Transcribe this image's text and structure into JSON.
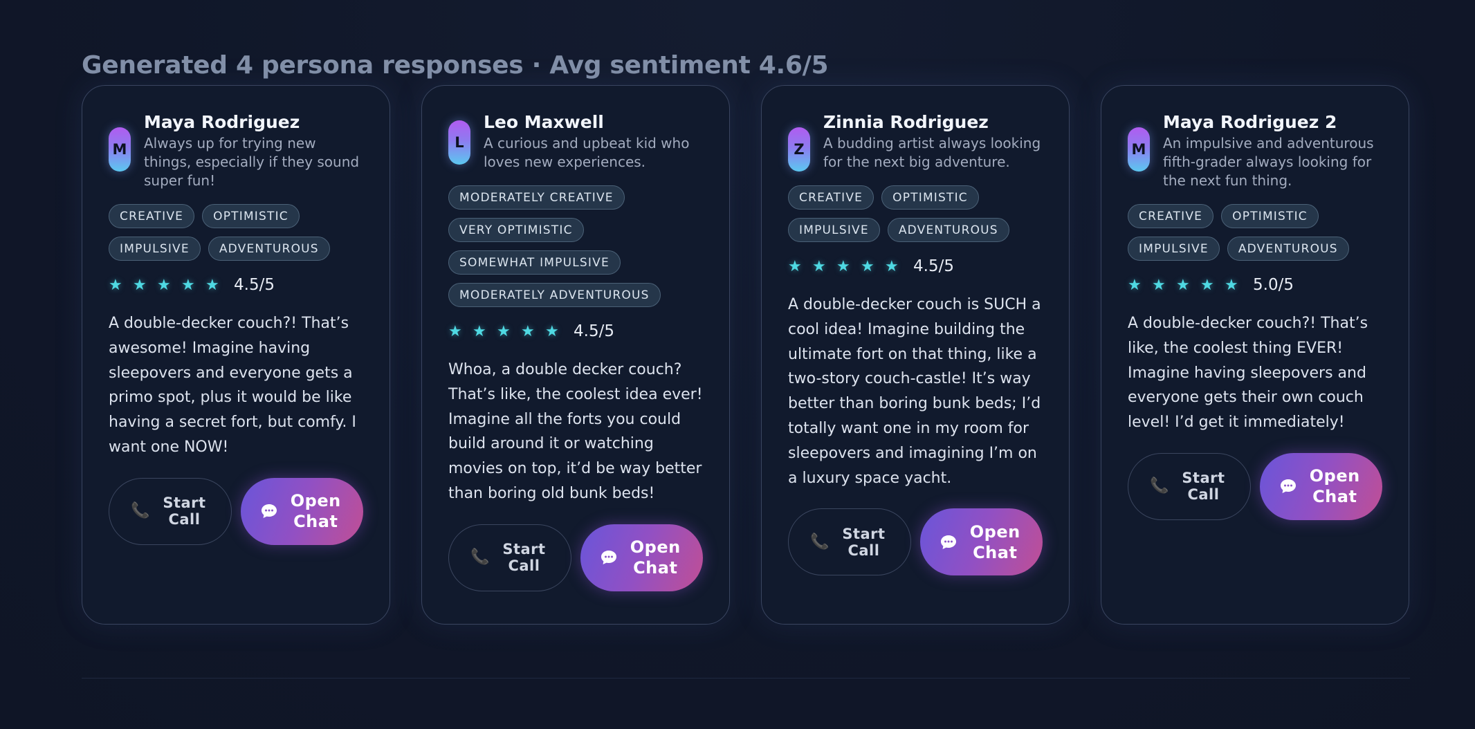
{
  "summary": "Generated 4 persona responses · Avg sentiment 4.6/5",
  "buttons": {
    "call": "Start Call",
    "chat": "Open Chat"
  },
  "colors": {
    "accent_star": "#4fd9e3",
    "chat_gradient_start": "#6a55d9",
    "chat_gradient_end": "#c04f95"
  },
  "personas": [
    {
      "initial": "M",
      "name": "Maya Rodriguez",
      "bio": "Always up for trying new things, especially if they sound super fun!",
      "tags": [
        "CREATIVE",
        "OPTIMISTIC",
        "IMPULSIVE",
        "ADVENTUROUS"
      ],
      "stars": 5,
      "score": "4.5/5",
      "response": "A double-decker couch?! That’s awesome! Imagine having sleepovers and everyone gets a primo spot, plus it would be like having a secret fort, but comfy. I want one NOW!"
    },
    {
      "initial": "L",
      "name": "Leo Maxwell",
      "bio": "A curious and upbeat kid who loves new experiences.",
      "tags": [
        "MODERATELY CREATIVE",
        "VERY OPTIMISTIC",
        "SOMEWHAT IMPULSIVE",
        "MODERATELY ADVENTUROUS"
      ],
      "stars": 5,
      "score": "4.5/5",
      "response": "Whoa, a double decker couch? That’s like, the coolest idea ever! Imagine all the forts you could build around it or watching movies on top, it’d be way better than boring old bunk beds!"
    },
    {
      "initial": "Z",
      "name": "Zinnia Rodriguez",
      "bio": "A budding artist always looking for the next big adventure.",
      "tags": [
        "CREATIVE",
        "OPTIMISTIC",
        "IMPULSIVE",
        "ADVENTUROUS"
      ],
      "stars": 5,
      "score": "4.5/5",
      "response": "A double-decker couch is SUCH a cool idea! Imagine building the ultimate fort on that thing, like a two-story couch-castle! It’s way better than boring bunk beds; I’d totally want one in my room for sleepovers and imagining I’m on a luxury space yacht."
    },
    {
      "initial": "M",
      "name": "Maya Rodriguez 2",
      "bio": "An impulsive and adventurous fifth-grader always looking for the next fun thing.",
      "tags": [
        "CREATIVE",
        "OPTIMISTIC",
        "IMPULSIVE",
        "ADVENTUROUS"
      ],
      "stars": 5,
      "score": "5.0/5",
      "response": "A double-decker couch?! That’s like, the coolest thing EVER! Imagine having sleepovers and everyone gets their own couch level! I’d get it immediately!"
    }
  ]
}
